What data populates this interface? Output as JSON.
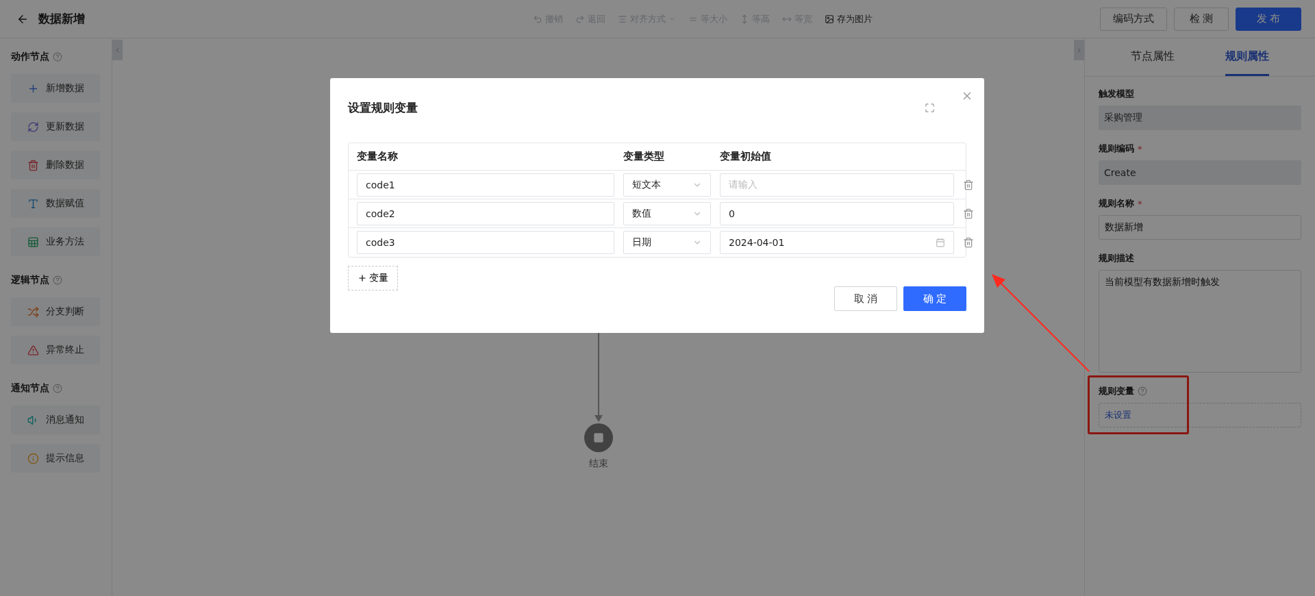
{
  "header": {
    "title": "数据新增"
  },
  "toolbar": [
    {
      "label": "撤销",
      "disabled": true
    },
    {
      "label": "返回",
      "disabled": true
    },
    {
      "label": "对齐方式",
      "disabled": true,
      "kind": "dropdown"
    },
    {
      "label": "等大小",
      "disabled": true
    },
    {
      "label": "等高",
      "disabled": true
    },
    {
      "label": "等宽",
      "disabled": true
    },
    {
      "label": "存为图片",
      "disabled": false
    }
  ],
  "header_buttons": [
    {
      "label": "编码方式",
      "primary": false
    },
    {
      "label": "检 测",
      "primary": false
    },
    {
      "label": "发 布",
      "primary": true
    }
  ],
  "sidebar": {
    "sections": [
      {
        "title": "动作节点",
        "items": [
          {
            "label": "新增数据"
          },
          {
            "label": "更新数据"
          },
          {
            "label": "删除数据"
          },
          {
            "label": "数据赋值"
          },
          {
            "label": "业务方法"
          }
        ]
      },
      {
        "title": "逻辑节点",
        "items": [
          {
            "label": "分支判断"
          },
          {
            "label": "异常终止"
          }
        ]
      },
      {
        "title": "通知节点",
        "items": [
          {
            "label": "消息通知"
          },
          {
            "label": "提示信息"
          }
        ]
      }
    ]
  },
  "canvas": {
    "end_node": {
      "label": "结束"
    }
  },
  "right_panel": {
    "tabs": [
      {
        "label": "节点属性",
        "selected": false
      },
      {
        "label": "规则属性",
        "selected": true
      }
    ],
    "fields": [
      {
        "label": "触发模型",
        "kind": "readonly",
        "value": "采购管理"
      },
      {
        "label": "规则编码",
        "required_mark": "*",
        "kind": "readonly",
        "value": "Create"
      },
      {
        "label": "规则名称",
        "required_mark": "*",
        "kind": "input",
        "value": "数据新增"
      },
      {
        "label": "规则描述",
        "kind": "textarea",
        "value": "当前模型有数据新增时触发"
      },
      {
        "label": "规则变量",
        "kind": "variables",
        "value": "未设置",
        "help": true
      }
    ]
  },
  "modal": {
    "title": "设置规则变量",
    "columns": [
      "变量名称",
      "变量类型",
      "变量初始值"
    ],
    "rows": [
      {
        "name": "code1",
        "type": "短文本",
        "kind": "text",
        "placeholder": "请输入"
      },
      {
        "name": "code2",
        "type": "数值",
        "kind": "number",
        "value": "0"
      },
      {
        "name": "code3",
        "type": "日期",
        "kind": "date",
        "value": "2024-04-01"
      }
    ],
    "add_button": "变量",
    "buttons": [
      {
        "label": "取 消",
        "primary": false
      },
      {
        "label": "确 定",
        "primary": true
      }
    ]
  }
}
